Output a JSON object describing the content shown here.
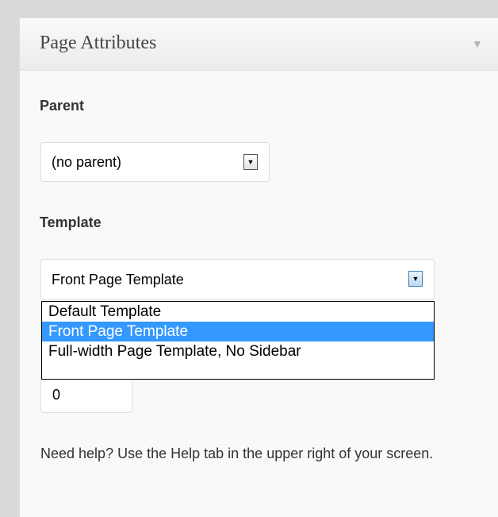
{
  "panel": {
    "title": "Page Attributes",
    "toggle_icon": "triangle-down-icon"
  },
  "parent": {
    "label": "Parent",
    "selected": "(no parent)"
  },
  "template": {
    "label": "Template",
    "selected": "Front Page Template",
    "options": [
      "Default Template",
      "Front Page Template",
      "Full-width Page Template, No Sidebar"
    ],
    "highlighted_index": 1
  },
  "order": {
    "value": "0"
  },
  "help": {
    "text": "Need help? Use the Help tab in the upper right of your screen."
  },
  "colors": {
    "highlight": "#3399ff",
    "panel_bg": "#f9f9f9",
    "page_bg": "#d9d9d9"
  }
}
